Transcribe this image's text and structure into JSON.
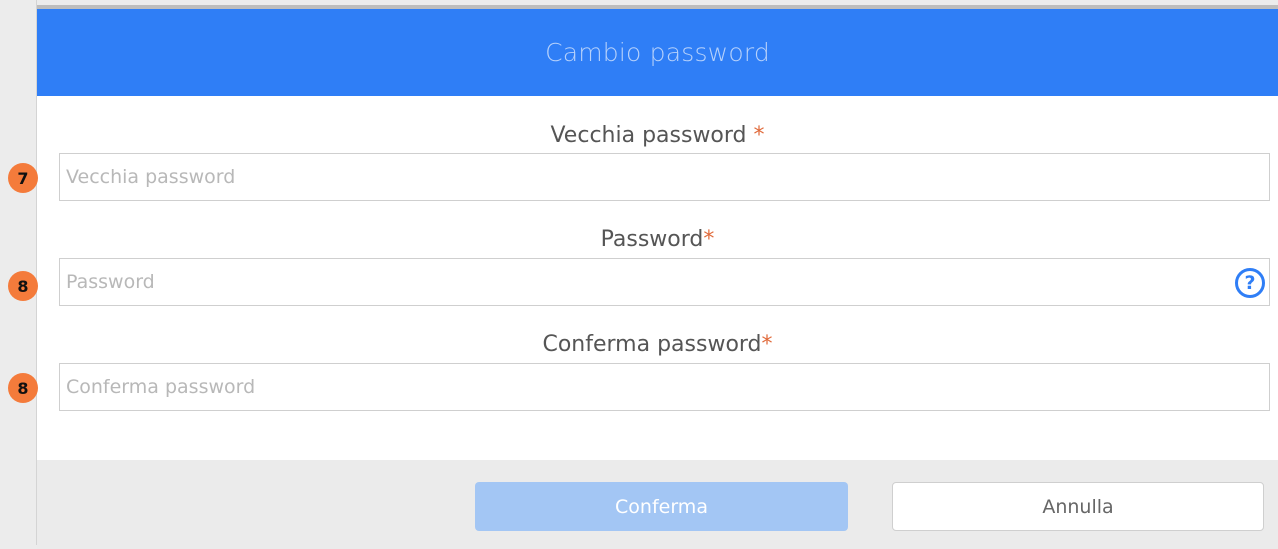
{
  "dialog": {
    "title": "Cambio password"
  },
  "fields": {
    "old_password": {
      "label": "Vecchia password ",
      "required_mark": "*",
      "placeholder": "Vecchia password",
      "badge": "7"
    },
    "new_password": {
      "label": "Password",
      "required_mark": "*",
      "placeholder": "Password",
      "badge": "8",
      "help_icon": "?"
    },
    "confirm_password": {
      "label": "Conferma password",
      "required_mark": "*",
      "placeholder": "Conferma password",
      "badge": "8"
    }
  },
  "footer": {
    "confirm_label": "Conferma",
    "cancel_label": "Annulla"
  },
  "colors": {
    "header_blue": "#2f7ef6",
    "required_orange": "#e06a3b",
    "badge_orange": "#f47b3b",
    "confirm_disabled": "#a3c6f4"
  },
  "icons": {
    "help": "question-circle-icon"
  }
}
